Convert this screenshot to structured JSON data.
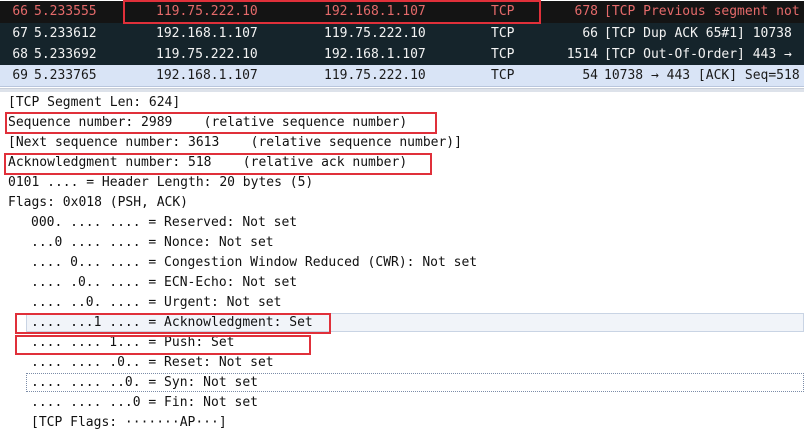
{
  "packet_list": {
    "rows": [
      {
        "no": "66",
        "time": "5.233555",
        "src": "119.75.222.10",
        "dst": "192.168.1.107",
        "proto": "TCP",
        "len": "678",
        "info": "[TCP Previous segment not"
      },
      {
        "no": "67",
        "time": "5.233612",
        "src": "192.168.1.107",
        "dst": "119.75.222.10",
        "proto": "TCP",
        "len": "66",
        "info": "[TCP Dup ACK 65#1] 10738"
      },
      {
        "no": "68",
        "time": "5.233692",
        "src": "119.75.222.10",
        "dst": "192.168.1.107",
        "proto": "TCP",
        "len": "1514",
        "info": "[TCP Out-Of-Order] 443 →"
      },
      {
        "no": "69",
        "time": "5.233765",
        "src": "192.168.1.107",
        "dst": "119.75.222.10",
        "proto": "TCP",
        "len": "54",
        "info": "10738 → 443 [ACK] Seq=518"
      }
    ]
  },
  "details": {
    "lines": [
      "[TCP Segment Len: 624]",
      "Sequence number: 2989    (relative sequence number)",
      "[Next sequence number: 3613    (relative sequence number)]",
      "Acknowledgment number: 518    (relative ack number)",
      "0101 .... = Header Length: 20 bytes (5)",
      "Flags: 0x018 (PSH, ACK)",
      "000. .... .... = Reserved: Not set",
      "...0 .... .... = Nonce: Not set",
      ".... 0... .... = Congestion Window Reduced (CWR): Not set",
      ".... .0.. .... = ECN-Echo: Not set",
      ".... ..0. .... = Urgent: Not set",
      ".... ...1 .... = Acknowledgment: Set",
      ".... .... 1... = Push: Set",
      ".... .... .0.. = Reset: Not set",
      ".... .... ..0. = Syn: Not set",
      ".... .... ...0 = Fin: Not set",
      "[TCP Flags: ·······AP···]"
    ]
  },
  "colors": {
    "annotation": "#e0303a",
    "selected_row": "#d9e4f6",
    "dark_row": "#15242b",
    "black_row": "#141414",
    "error_text": "#e56a6a"
  }
}
